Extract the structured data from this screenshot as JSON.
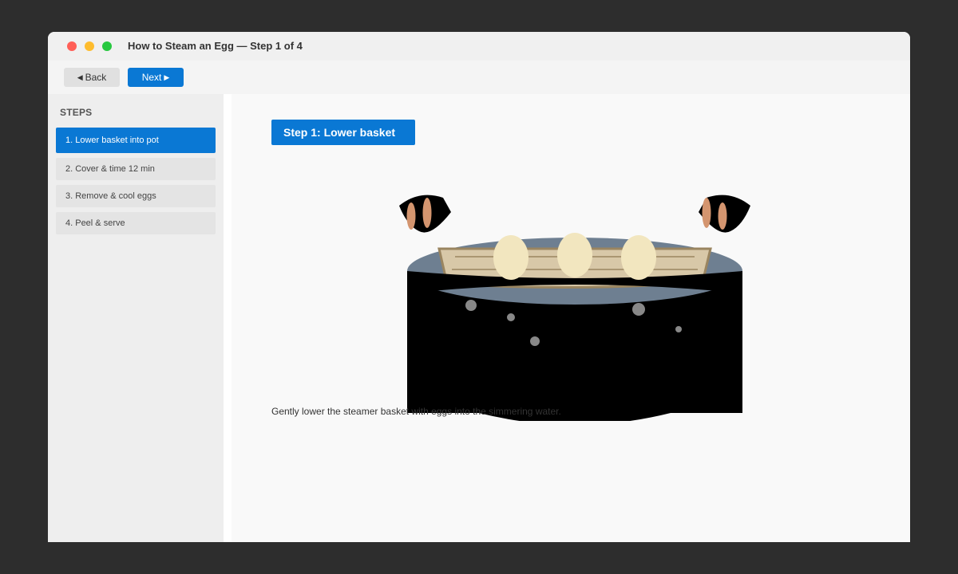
{
  "window": {
    "title": "How to Steam an Egg — Step 1 of 4"
  },
  "toolbar": {
    "back_label": "Back",
    "next_label": "Next",
    "back_icon": "triangle-left-icon",
    "next_icon": "triangle-right-icon"
  },
  "sidebar": {
    "heading": "STEPS",
    "items": [
      {
        "label": "1. Lower basket into pot",
        "active": true
      },
      {
        "label": "2. Cover & time 12 min",
        "active": false
      },
      {
        "label": "3. Remove & cool eggs",
        "active": false
      },
      {
        "label": "4. Peel & serve",
        "active": false
      }
    ]
  },
  "main": {
    "step_title": "Step 1: Lower basket",
    "caption": "Gently lower the steamer basket with eggs into the simmering water."
  },
  "colors": {
    "accent": "#0a78d4",
    "pot": "#000000",
    "water": "#6e7f91",
    "basket": "#d8c8a8",
    "egg": "#f2e6bf",
    "hand": "#d4956f"
  }
}
